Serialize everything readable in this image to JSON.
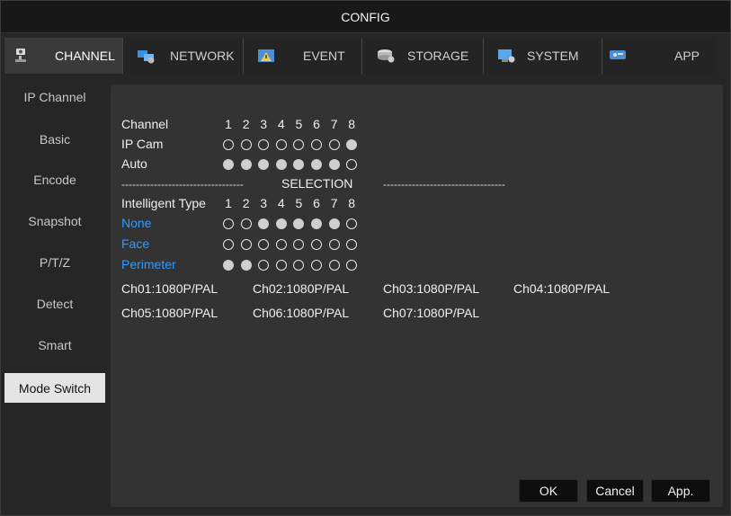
{
  "title": "CONFIG",
  "tabs": [
    {
      "label": "CHANNEL",
      "icon": "camera-icon",
      "active": true
    },
    {
      "label": "NETWORK",
      "icon": "network-icon",
      "active": false
    },
    {
      "label": "EVENT",
      "icon": "event-warning-icon",
      "active": false
    },
    {
      "label": "STORAGE",
      "icon": "storage-icon",
      "active": false
    },
    {
      "label": "SYSTEM",
      "icon": "system-icon",
      "active": false
    },
    {
      "label": "APP",
      "icon": "app-icon",
      "active": false
    }
  ],
  "sidebar": {
    "items": [
      {
        "label": "IP Channel"
      },
      {
        "label": "Basic"
      },
      {
        "label": "Encode"
      },
      {
        "label": "Snapshot"
      },
      {
        "label": "P/T/Z"
      },
      {
        "label": "Detect"
      },
      {
        "label": "Smart"
      },
      {
        "label": "Mode Switch",
        "active": true
      }
    ]
  },
  "mode": {
    "channel_label": "Channel",
    "channel_numbers": [
      "1",
      "2",
      "3",
      "4",
      "5",
      "6",
      "7",
      "8"
    ],
    "rows": [
      {
        "label": "IP Cam",
        "selected": [
          false,
          false,
          false,
          false,
          false,
          false,
          false,
          true
        ]
      },
      {
        "label": "Auto",
        "selected": [
          true,
          true,
          true,
          true,
          true,
          true,
          true,
          false
        ]
      }
    ]
  },
  "selection": {
    "dashes_left": "----------------------------------",
    "title": "SELECTION",
    "dashes_right": "----------------------------------"
  },
  "intelligent": {
    "type_label": "Intelligent Type",
    "channel_numbers": [
      "1",
      "2",
      "3",
      "4",
      "5",
      "6",
      "7",
      "8"
    ],
    "rows": [
      {
        "label": "None",
        "selected": [
          false,
          false,
          true,
          true,
          true,
          true,
          true,
          false
        ]
      },
      {
        "label": "Face",
        "selected": [
          false,
          false,
          false,
          false,
          false,
          false,
          false,
          false
        ]
      },
      {
        "label": "Perimeter",
        "selected": [
          true,
          true,
          false,
          false,
          false,
          false,
          false,
          false
        ]
      }
    ]
  },
  "channel_info": [
    "Ch01:1080P/PAL",
    "Ch02:1080P/PAL",
    "Ch03:1080P/PAL",
    "Ch04:1080P/PAL",
    "Ch05:1080P/PAL",
    "Ch06:1080P/PAL",
    "Ch07:1080P/PAL"
  ],
  "buttons": {
    "ok": "OK",
    "cancel": "Cancel",
    "apply": "App."
  },
  "colors": {
    "accent_blue": "#2f9bff",
    "background": "#262626",
    "panel": "#333333"
  }
}
